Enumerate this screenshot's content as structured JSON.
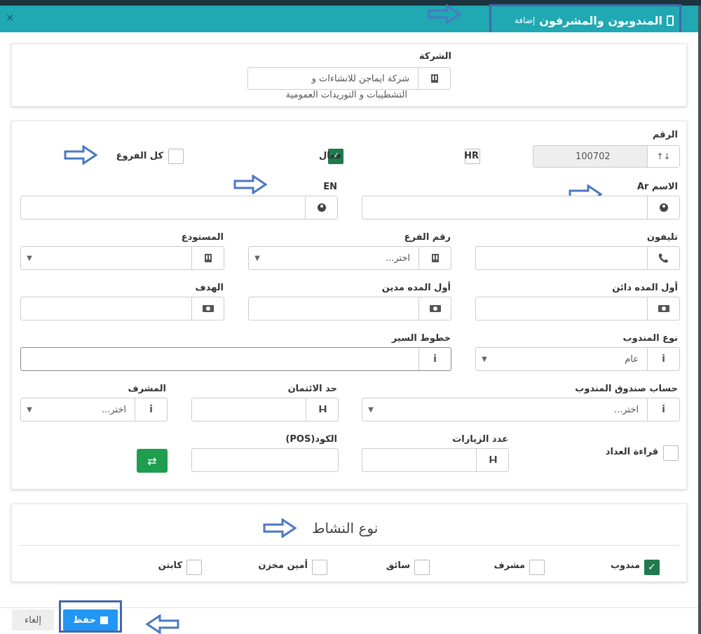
{
  "header": {
    "title": "المندوبون والمشرفون",
    "subtitle": "إضافة",
    "close": "×"
  },
  "company": {
    "label": "الشركة",
    "value_line1": "شركة ايماجن للانشاءات و",
    "value_line2": "التشطيبات و التوريدات العمومية"
  },
  "form": {
    "number_label": "الرقم",
    "number_value": "100702",
    "hr_label": "HR",
    "active_label": "فعال",
    "all_branches_label": "كل الفروع",
    "name_ar_label": "الاسم Ar",
    "name_en_label": "EN",
    "phone_label": "تليفون",
    "branch_no_label": "رقم الفرع",
    "branch_no_placeholder": "اختر...",
    "warehouse_label": "المستودع",
    "opening_credit_label": "أول المده دائن",
    "opening_debit_label": "أول المده مدين",
    "target_label": "الهدف",
    "rep_type_label": "نوع المندوب",
    "rep_type_value": "عام",
    "routes_label": "خطوط السير",
    "rep_box_label": "حساب صندوق المندوب",
    "rep_box_placeholder": "اختر...",
    "credit_limit_label": "حد الائتمان",
    "supervisor_label": "المشرف",
    "supervisor_placeholder": "اختر...",
    "meter_reading_label": "قراءة العداد",
    "visits_label": "عدد الزيارات",
    "pos_code_label": "الكود(POS)"
  },
  "activity": {
    "title": "نوع النشاط",
    "options": [
      {
        "label": "مندوب",
        "checked": true
      },
      {
        "label": "مشرف",
        "checked": false
      },
      {
        "label": "سائق",
        "checked": false
      },
      {
        "label": "أمين مخزن",
        "checked": false
      },
      {
        "label": "كابتن",
        "checked": false
      }
    ]
  },
  "footer": {
    "save_label": "حفظ",
    "cancel_label": "إلغاء"
  },
  "colors": {
    "header": "#20a8b3",
    "check_green": "#1f7a4d",
    "save_blue": "#2196f3",
    "annotation_arrow": "#4a78c2"
  },
  "icons": {
    "sort": "sort-icon",
    "user": "user-icon",
    "building": "building-icon",
    "phone": "phone-icon",
    "money": "money-icon",
    "info": "info-icon",
    "dumbbell": "dumbbell-icon",
    "refresh": "refresh-icon",
    "save": "save-icon"
  }
}
